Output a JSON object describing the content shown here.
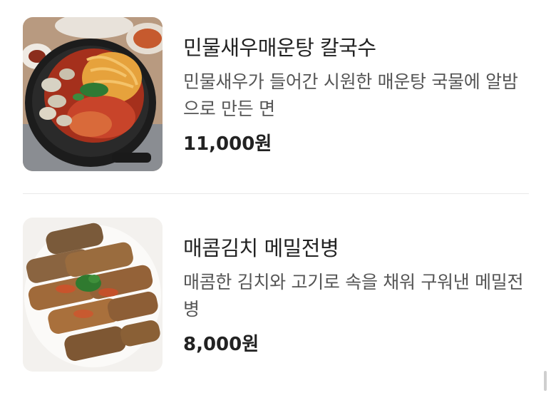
{
  "menu": {
    "items": [
      {
        "name": "민물새우매운탕 칼국수",
        "description": "민물새우가 들어간 시원한 매운탕 국물에 알밤으로 만든 면",
        "price": "11,000원",
        "image_icon": "stew-photo"
      },
      {
        "name": "매콤김치 메밀전병",
        "description": "매콤한 김치와 고기로 속을 채워 구워낸 메밀전병",
        "price": "8,000원",
        "image_icon": "pancake-photo"
      }
    ]
  },
  "colors": {
    "text_primary": "#222222",
    "text_secondary": "#555555",
    "divider": "#e9e9e9",
    "background": "#ffffff"
  }
}
